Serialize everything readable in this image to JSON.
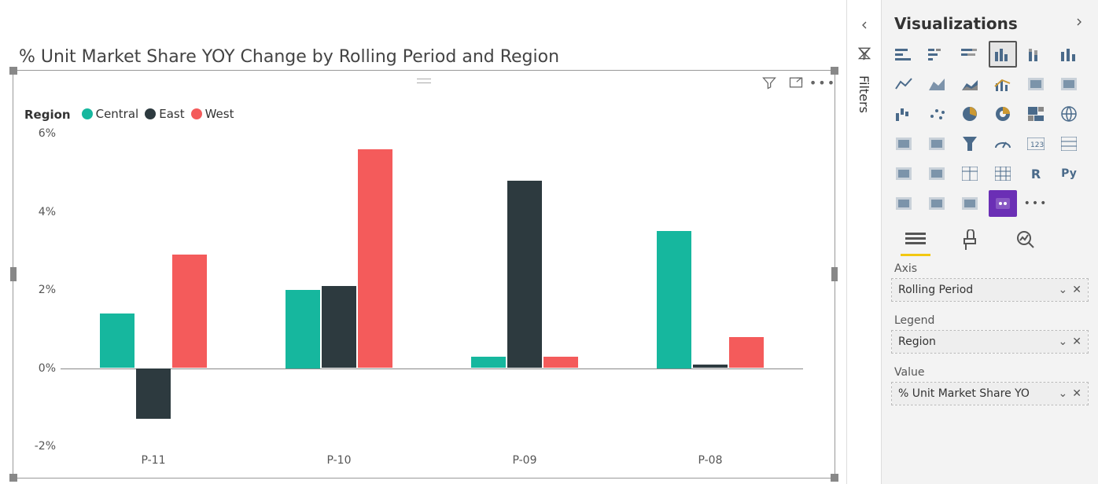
{
  "chart_data": {
    "type": "bar",
    "title": "% Unit Market Share YOY Change by Rolling Period and Region",
    "xlabel": "",
    "ylabel": "",
    "y_ticks": [
      "6%",
      "4%",
      "2%",
      "0%",
      "-2%"
    ],
    "ylim": [
      -2,
      6
    ],
    "categories": [
      "P-11",
      "P-10",
      "P-09",
      "P-08"
    ],
    "legend_title": "Region",
    "series": [
      {
        "name": "Central",
        "color": "#16b79e",
        "values": [
          1.4,
          2.0,
          0.3,
          3.5
        ]
      },
      {
        "name": "East",
        "color": "#2d3a3f",
        "values": [
          -1.3,
          2.1,
          4.8,
          0.1
        ]
      },
      {
        "name": "West",
        "color": "#f45b5b",
        "values": [
          2.9,
          5.6,
          0.3,
          0.8
        ]
      }
    ]
  },
  "visual_header": {
    "filter_icon": "filter-icon",
    "focus_icon": "focus-mode-icon",
    "more_icon": "more-options-icon"
  },
  "filters_rail": {
    "expand_icon": "chevron-left-icon",
    "label": "Filters"
  },
  "viz_pane": {
    "title": "Visualizations",
    "collapse_icon": "chevron-right-icon",
    "icons": [
      "stacked-bar-icon",
      "clustered-bar-icon",
      "stacked-bar-h-icon",
      "clustered-column-icon",
      "stacked-column-icon",
      "100pct-column-icon",
      "line-icon",
      "area-icon",
      "stacked-area-icon",
      "line-column-icon",
      "line-clustered-icon",
      "ribbon-icon",
      "waterfall-icon",
      "scatter-icon",
      "pie-icon",
      "donut-icon",
      "treemap-icon",
      "map-icon",
      "filled-map-icon",
      "shape-map-icon",
      "funnel-icon",
      "gauge-icon",
      "card-icon",
      "multirow-icon",
      "kpi-icon",
      "slicer-icon",
      "table-icon",
      "matrix-icon",
      "r-visual-icon",
      "python-visual-icon",
      "key-influencers-icon",
      "qa-icon",
      "arcgis-icon",
      "powerapps-icon",
      "more-visuals-icon"
    ],
    "selected_icon_index": 3,
    "custom_icon_index": 33,
    "tabs": {
      "fields_icon": "fields-tab-icon",
      "format_icon": "format-tab-icon",
      "analytics_icon": "analytics-tab-icon"
    },
    "sections": {
      "axis_label": "Axis",
      "legend_label": "Legend",
      "value_label": "Value",
      "axis_field": "Rolling Period",
      "legend_field": "Region",
      "value_field": "% Unit Market Share YO"
    }
  }
}
